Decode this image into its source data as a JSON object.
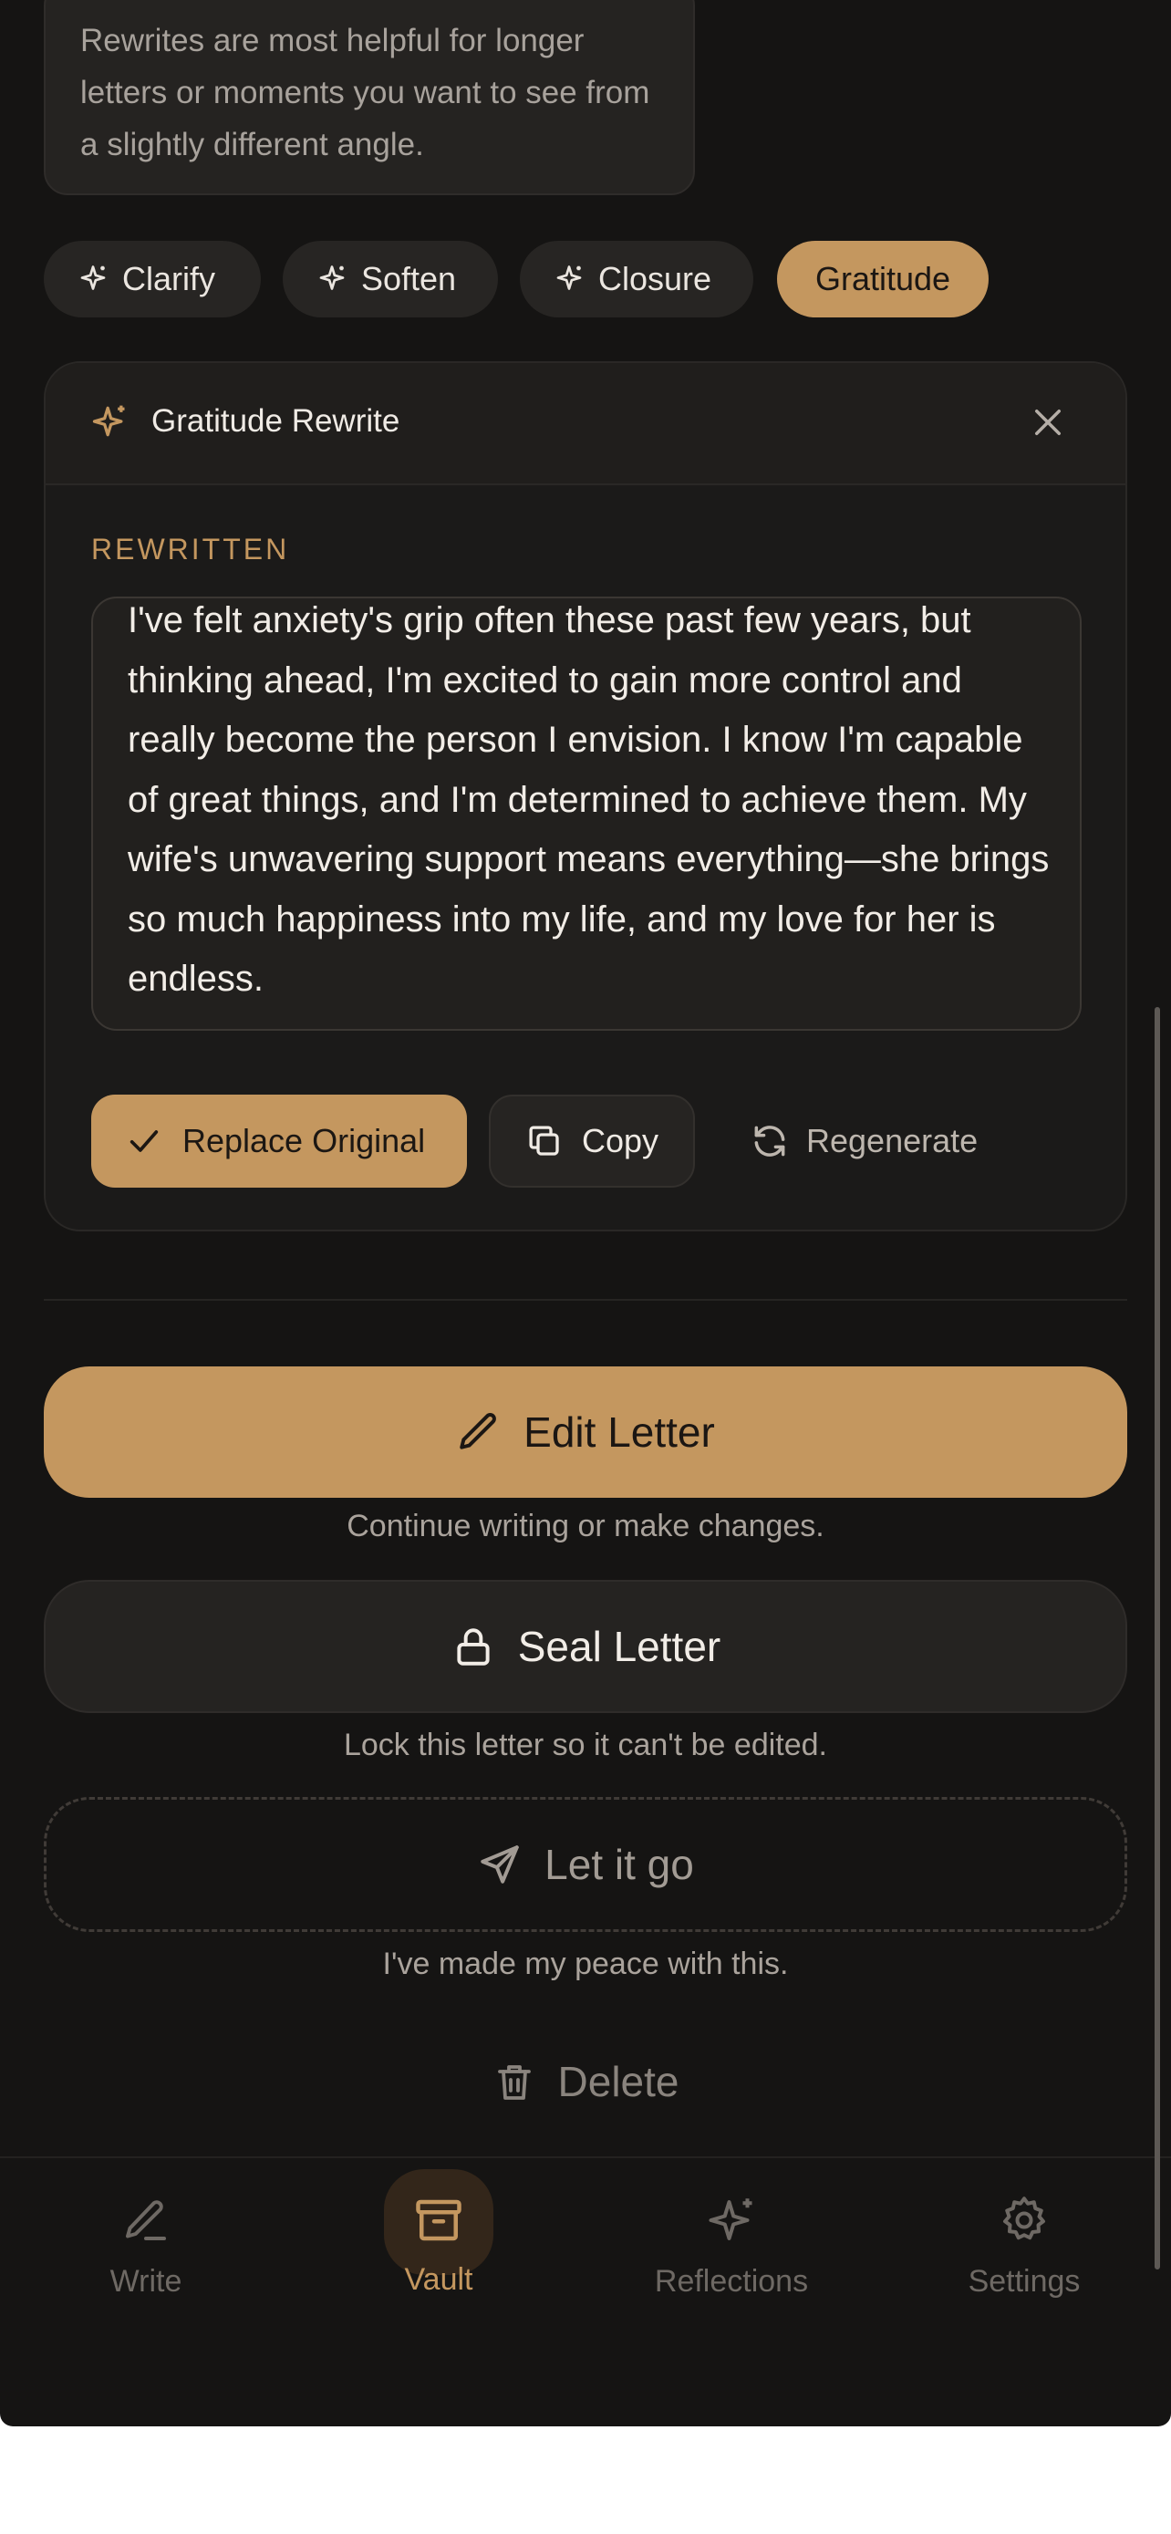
{
  "note": {
    "text": "Rewrites are most helpful for longer letters or moments you want to see from a slightly different angle."
  },
  "chips": [
    {
      "label": "Clarify",
      "icon": "sparkle-icon"
    },
    {
      "label": "Soften",
      "icon": "sparkle-icon"
    },
    {
      "label": "Closure",
      "icon": "sparkle-icon"
    },
    {
      "label": "Gratitude",
      "active": true
    }
  ],
  "rewrite": {
    "title": "Gratitude Rewrite",
    "label": "REWRITTEN",
    "text": "I've felt anxiety's grip often these past few years, but thinking ahead, I'm excited to gain more control and really become the person I envision. I know I'm capable of great things, and I'm determined to achieve them. My wife's unwavering support means everything—she brings so much happiness into my life, and my love for her is endless.",
    "replace_label": "Replace Original",
    "copy_label": "Copy",
    "regenerate_label": "Regenerate"
  },
  "actions": {
    "edit_label": "Edit Letter",
    "edit_sub": "Continue writing or make changes.",
    "seal_label": "Seal Letter",
    "seal_sub": "Lock this letter so it can't be edited.",
    "letgo_label": "Let it go",
    "letgo_sub": "I've made my peace with this.",
    "delete_label": "Delete"
  },
  "tabs": [
    {
      "label": "Write",
      "icon": "pencil-icon"
    },
    {
      "label": "Vault",
      "icon": "archive-icon",
      "active": true
    },
    {
      "label": "Reflections",
      "icon": "sparkle-icon"
    },
    {
      "label": "Settings",
      "icon": "gear-icon"
    }
  ],
  "colors": {
    "background": "#151413",
    "accent": "#c4975f",
    "card": "#1b1a19",
    "text": "#f2ede7",
    "muted": "#aaa39c"
  }
}
